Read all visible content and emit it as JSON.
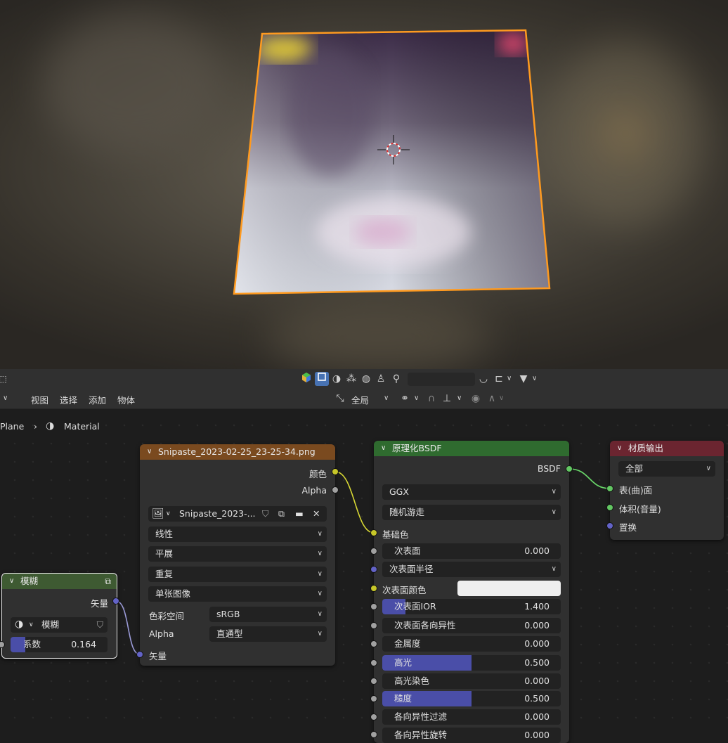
{
  "header": {
    "menus": [
      "视图",
      "选择",
      "添加",
      "物体"
    ],
    "transform_orientation": "全局"
  },
  "breadcrumb": {
    "object": "Plane",
    "material": "Material"
  },
  "nodes": {
    "blur": {
      "title": "模糊",
      "output_vector": "矢量",
      "type_value": "模糊",
      "factor_label": "系数",
      "factor_value": "0.164",
      "factor_fraction": 0.164
    },
    "image": {
      "title": "Snipaste_2023-02-25_23-25-34.png",
      "output_color": "颜色",
      "output_alpha": "Alpha",
      "image_name": "Snipaste_2023-...",
      "interpolation": "线性",
      "projection": "平展",
      "extension": "重复",
      "source": "单张图像",
      "colorspace_label": "色彩空间",
      "colorspace_value": "sRGB",
      "alpha_label": "Alpha",
      "alpha_value": "直通型",
      "input_vector": "矢量"
    },
    "bsdf": {
      "title": "原理化BSDF",
      "output": "BSDF",
      "distribution": "GGX",
      "subsurface_method": "随机游走",
      "base_color": "基础色",
      "props": [
        {
          "label": "次表面",
          "value": "0.000",
          "fraction": 0
        },
        {
          "label": "次表面半径",
          "value": "",
          "fraction": 0
        },
        {
          "label": "次表面颜色",
          "value": "",
          "fraction": 0
        },
        {
          "label": "次表面IOR",
          "value": "1.400",
          "fraction": 0.13
        },
        {
          "label": "次表面各向异性",
          "value": "0.000",
          "fraction": 0
        },
        {
          "label": "金属度",
          "value": "0.000",
          "fraction": 0
        },
        {
          "label": "高光",
          "value": "0.500",
          "fraction": 0.5
        },
        {
          "label": "高光染色",
          "value": "0.000",
          "fraction": 0
        },
        {
          "label": "糙度",
          "value": "0.500",
          "fraction": 0.5
        },
        {
          "label": "各向异性过滤",
          "value": "0.000",
          "fraction": 0
        },
        {
          "label": "各向异性旋转",
          "value": "0.000",
          "fraction": 0
        }
      ]
    },
    "output": {
      "title": "材质输出",
      "target": "全部",
      "surface": "表(曲)面",
      "volume": "体积(音量)",
      "displacement": "置换"
    }
  },
  "colors": {
    "selection_outline": "#ff9a1f",
    "image_header": "#7a4a1f",
    "shader_header": "#2f6b2f",
    "output_header": "#6b2530",
    "vector_header": "#3e5a32",
    "slider_fill": "#4a4ea8"
  }
}
